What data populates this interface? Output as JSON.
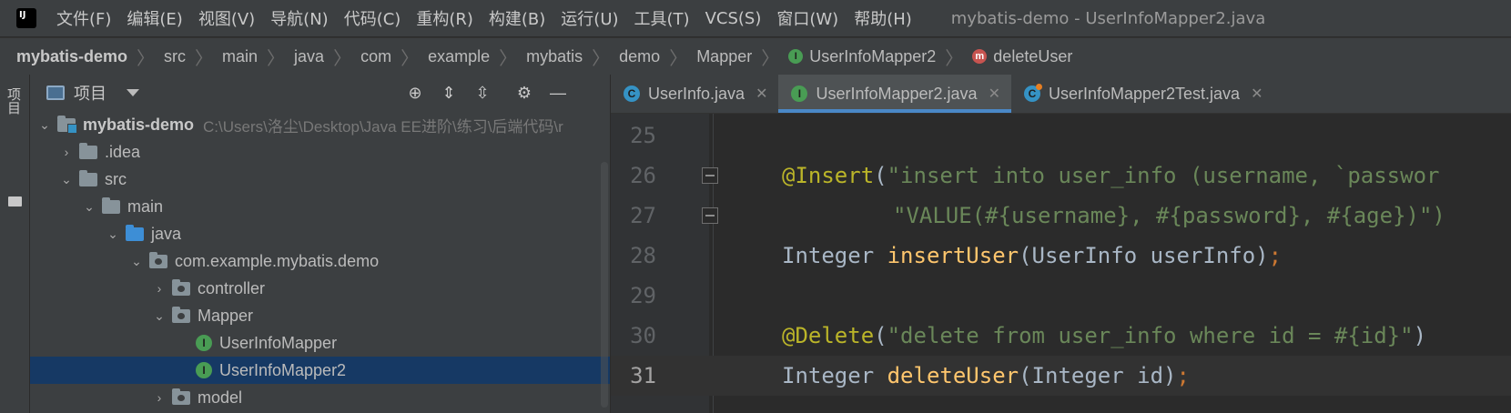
{
  "menubar": {
    "items": [
      "文件(F)",
      "编辑(E)",
      "视图(V)",
      "导航(N)",
      "代码(C)",
      "重构(R)",
      "构建(B)",
      "运行(U)",
      "工具(T)",
      "VCS(S)",
      "窗口(W)",
      "帮助(H)"
    ],
    "window_title": "mybatis-demo - UserInfoMapper2.java",
    "logo_text": "IJ"
  },
  "breadcrumb": {
    "items": [
      "mybatis-demo",
      "src",
      "main",
      "java",
      "com",
      "example",
      "mybatis",
      "demo",
      "Mapper",
      "UserInfoMapper2",
      "deleteUser"
    ]
  },
  "left_strip": {
    "tab_label": "项目"
  },
  "project_panel": {
    "title": "项目",
    "tree": [
      {
        "label": "mybatis-demo",
        "path": "C:\\Users\\洛尘\\Desktop\\Java EE进阶\\练习\\后端代码\\r"
      },
      {
        "label": ".idea"
      },
      {
        "label": "src"
      },
      {
        "label": "main"
      },
      {
        "label": "java"
      },
      {
        "label": "com.example.mybatis.demo"
      },
      {
        "label": "controller"
      },
      {
        "label": "Mapper"
      },
      {
        "label": "UserInfoMapper"
      },
      {
        "label": "UserInfoMapper2"
      },
      {
        "label": "model"
      }
    ]
  },
  "editor": {
    "tabs": [
      {
        "label": "UserInfo.java",
        "icon_text": "C"
      },
      {
        "label": "UserInfoMapper2.java",
        "icon_text": "I"
      },
      {
        "label": "UserInfoMapper2Test.java",
        "icon_text": "C"
      }
    ],
    "close_glyph": "✕",
    "lines": [
      {
        "num": "25"
      },
      {
        "num": "26",
        "annotation": "@Insert",
        "string": "\"insert into user_info (username, `passwor"
      },
      {
        "num": "27",
        "string": "\"VALUE(#{username}, #{password}, #{age})\")"
      },
      {
        "num": "28",
        "type": "Integer ",
        "method": "insertUser",
        "rest": "(UserInfo userInfo)",
        "semi": ";"
      },
      {
        "num": "29"
      },
      {
        "num": "30",
        "annotation": "@Delete",
        "string": "\"delete from user_info where id = #{id}\"",
        "close": ")"
      },
      {
        "num": "31",
        "type": "Integer ",
        "method": "deleteUser",
        "rest": "(Integer id)",
        "semi": ";"
      }
    ]
  },
  "colors": {
    "annotation": "#bbb529",
    "string": "#6a8759",
    "method": "#ffc66d",
    "keyword": "#cc7832",
    "selection": "#0d293e",
    "active_tab_underline": "#4a88c7"
  }
}
